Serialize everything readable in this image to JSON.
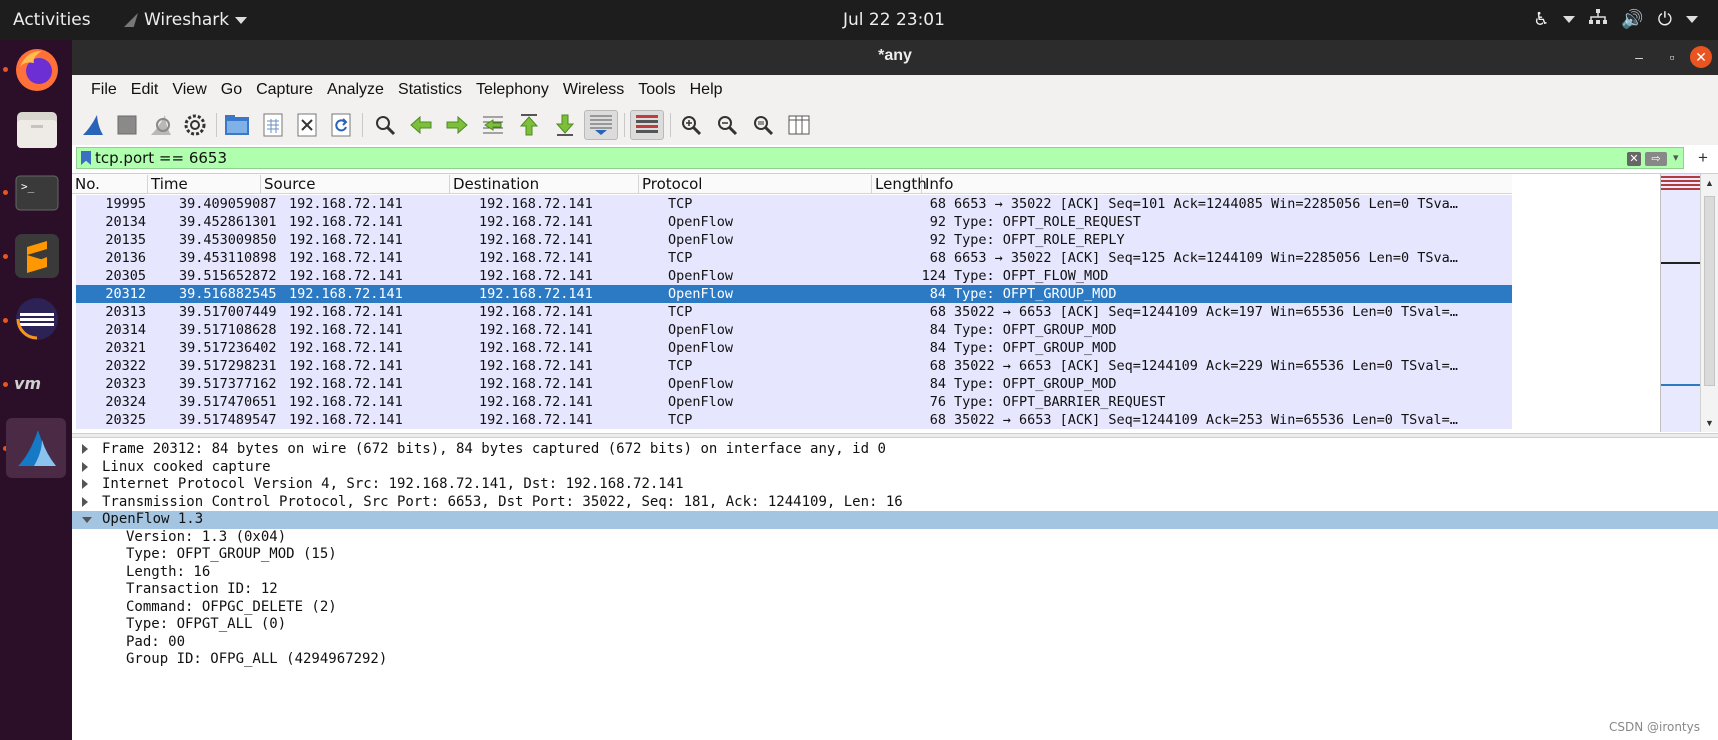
{
  "topbar": {
    "activities": "Activities",
    "app_name": "Wireshark",
    "clock": "Jul 22  23:01"
  },
  "window": {
    "title": "*any",
    "minimize": "–",
    "maximize": "▫",
    "close": "✕"
  },
  "menu": [
    "File",
    "Edit",
    "View",
    "Go",
    "Capture",
    "Analyze",
    "Statistics",
    "Telephony",
    "Wireless",
    "Tools",
    "Help"
  ],
  "filter": {
    "value": "tcp.port == 6653",
    "clear": "✕",
    "apply": "⇨",
    "dropdown": "▾",
    "add": "+"
  },
  "columns": {
    "no": "No.",
    "time": "Time",
    "source": "Source",
    "destination": "Destination",
    "protocol": "Protocol",
    "length": "Length",
    "info": "Info"
  },
  "packets": [
    {
      "no": "19995",
      "time": "39.409059087",
      "src": "192.168.72.141",
      "dst": "192.168.72.141",
      "proto": "TCP",
      "len": "68",
      "info": "6653 → 35022 [ACK] Seq=101 Ack=1244085 Win=2285056 Len=0 TSva…"
    },
    {
      "no": "20134",
      "time": "39.452861301",
      "src": "192.168.72.141",
      "dst": "192.168.72.141",
      "proto": "OpenFlow",
      "len": "92",
      "info": "Type: OFPT_ROLE_REQUEST"
    },
    {
      "no": "20135",
      "time": "39.453009850",
      "src": "192.168.72.141",
      "dst": "192.168.72.141",
      "proto": "OpenFlow",
      "len": "92",
      "info": "Type: OFPT_ROLE_REPLY"
    },
    {
      "no": "20136",
      "time": "39.453110898",
      "src": "192.168.72.141",
      "dst": "192.168.72.141",
      "proto": "TCP",
      "len": "68",
      "info": "6653 → 35022 [ACK] Seq=125 Ack=1244109 Win=2285056 Len=0 TSva…"
    },
    {
      "no": "20305",
      "time": "39.515652872",
      "src": "192.168.72.141",
      "dst": "192.168.72.141",
      "proto": "OpenFlow",
      "len": "124",
      "info": "Type: OFPT_FLOW_MOD"
    },
    {
      "no": "20312",
      "time": "39.516882545",
      "src": "192.168.72.141",
      "dst": "192.168.72.141",
      "proto": "OpenFlow",
      "len": "84",
      "info": "Type: OFPT_GROUP_MOD"
    },
    {
      "no": "20313",
      "time": "39.517007449",
      "src": "192.168.72.141",
      "dst": "192.168.72.141",
      "proto": "TCP",
      "len": "68",
      "info": "35022 → 6653 [ACK] Seq=1244109 Ack=197 Win=65536 Len=0 TSval=…"
    },
    {
      "no": "20314",
      "time": "39.517108628",
      "src": "192.168.72.141",
      "dst": "192.168.72.141",
      "proto": "OpenFlow",
      "len": "84",
      "info": "Type: OFPT_GROUP_MOD"
    },
    {
      "no": "20321",
      "time": "39.517236402",
      "src": "192.168.72.141",
      "dst": "192.168.72.141",
      "proto": "OpenFlow",
      "len": "84",
      "info": "Type: OFPT_GROUP_MOD"
    },
    {
      "no": "20322",
      "time": "39.517298231",
      "src": "192.168.72.141",
      "dst": "192.168.72.141",
      "proto": "TCP",
      "len": "68",
      "info": "35022 → 6653 [ACK] Seq=1244109 Ack=229 Win=65536 Len=0 TSval=…"
    },
    {
      "no": "20323",
      "time": "39.517377162",
      "src": "192.168.72.141",
      "dst": "192.168.72.141",
      "proto": "OpenFlow",
      "len": "84",
      "info": "Type: OFPT_GROUP_MOD"
    },
    {
      "no": "20324",
      "time": "39.517470651",
      "src": "192.168.72.141",
      "dst": "192.168.72.141",
      "proto": "OpenFlow",
      "len": "76",
      "info": "Type: OFPT_BARRIER_REQUEST"
    },
    {
      "no": "20325",
      "time": "39.517489547",
      "src": "192.168.72.141",
      "dst": "192.168.72.141",
      "proto": "TCP",
      "len": "68",
      "info": "35022 → 6653 [ACK] Seq=1244109 Ack=253 Win=65536 Len=0 TSval=…"
    }
  ],
  "selected_packet": "20312",
  "details": [
    {
      "text": "Frame 20312: 84 bytes on wire (672 bits), 84 bytes captured (672 bits) on interface any, id 0",
      "state": "collapsed",
      "level": 0
    },
    {
      "text": "Linux cooked capture",
      "state": "collapsed",
      "level": 0
    },
    {
      "text": "Internet Protocol Version 4, Src: 192.168.72.141, Dst: 192.168.72.141",
      "state": "collapsed",
      "level": 0
    },
    {
      "text": "Transmission Control Protocol, Src Port: 6653, Dst Port: 35022, Seq: 181, Ack: 1244109, Len: 16",
      "state": "collapsed",
      "level": 0
    },
    {
      "text": "OpenFlow 1.3",
      "state": "expanded",
      "level": 0,
      "selected": true
    },
    {
      "text": "Version: 1.3 (0x04)",
      "level": 1
    },
    {
      "text": "Type: OFPT_GROUP_MOD (15)",
      "level": 1
    },
    {
      "text": "Length: 16",
      "level": 1
    },
    {
      "text": "Transaction ID: 12",
      "level": 1
    },
    {
      "text": "Command: OFPGC_DELETE (2)",
      "level": 1
    },
    {
      "text": "Type: OFPGT_ALL (0)",
      "level": 1
    },
    {
      "text": "Pad: 00",
      "level": 1
    },
    {
      "text": "Group ID: OFPG_ALL (4294967292)",
      "level": 1
    }
  ],
  "watermark": "CSDN @irontys",
  "colors": {
    "filter_valid": "#afffaf",
    "row_bg": "#e7e6ff",
    "row_selected": "#2d7ac4",
    "detail_selected": "#a4c5e2",
    "accent": "#e95420"
  }
}
